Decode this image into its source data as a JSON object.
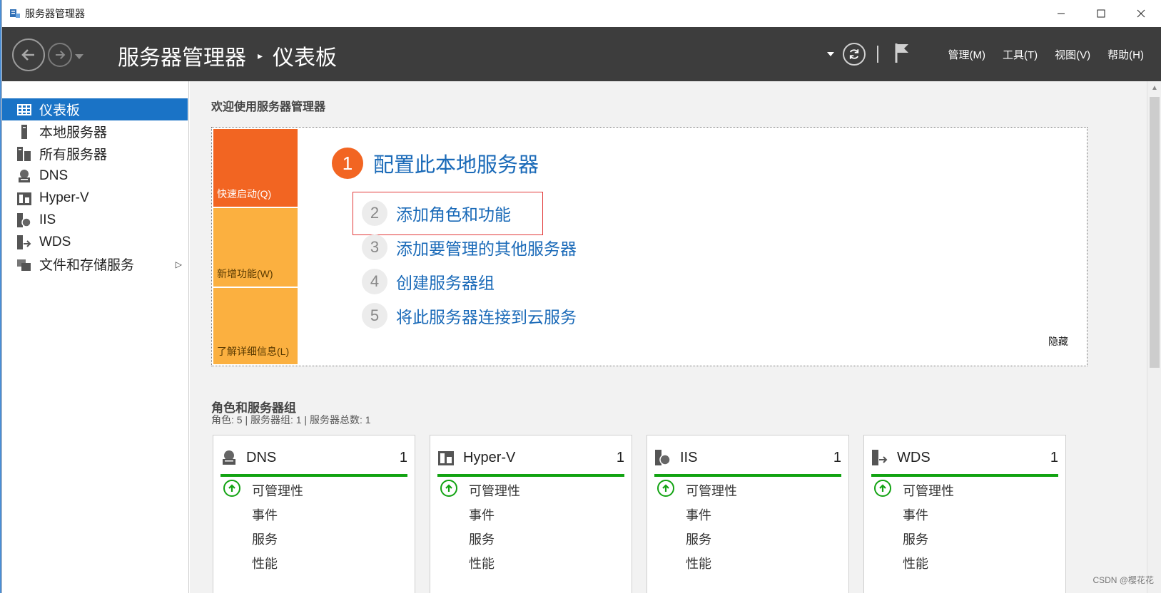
{
  "window": {
    "title": "服务器管理器"
  },
  "header": {
    "breadcrumb_root": "服务器管理器",
    "breadcrumb_sep": "▸",
    "breadcrumb_current": "仪表板",
    "menus": [
      "管理(M)",
      "工具(T)",
      "视图(V)",
      "帮助(H)"
    ]
  },
  "sidebar": {
    "items": [
      {
        "label": "仪表板",
        "icon": "dashboard-icon"
      },
      {
        "label": "本地服务器",
        "icon": "server-icon"
      },
      {
        "label": "所有服务器",
        "icon": "servers-icon"
      },
      {
        "label": "DNS",
        "icon": "dns-icon"
      },
      {
        "label": "Hyper-V",
        "icon": "hyperv-icon"
      },
      {
        "label": "IIS",
        "icon": "iis-icon"
      },
      {
        "label": "WDS",
        "icon": "wds-icon"
      },
      {
        "label": "文件和存储服务",
        "icon": "storage-icon"
      }
    ]
  },
  "main": {
    "welcome_title": "欢迎使用服务器管理器",
    "tiles": [
      "快速启动(Q)",
      "新增功能(W)",
      "了解详细信息(L)"
    ],
    "steps": [
      {
        "num": "1",
        "label": "配置此本地服务器"
      },
      {
        "num": "2",
        "label": "添加角色和功能"
      },
      {
        "num": "3",
        "label": "添加要管理的其他服务器"
      },
      {
        "num": "4",
        "label": "创建服务器组"
      },
      {
        "num": "5",
        "label": "将此服务器连接到云服务"
      }
    ],
    "hide_link": "隐藏",
    "roles_title": "角色和服务器组",
    "roles_sub": "角色: 5 | 服务器组: 1 | 服务器总数: 1",
    "cards": [
      {
        "name": "DNS",
        "count": "1",
        "rows": [
          "可管理性",
          "事件",
          "服务",
          "性能"
        ]
      },
      {
        "name": "Hyper-V",
        "count": "1",
        "rows": [
          "可管理性",
          "事件",
          "服务",
          "性能"
        ]
      },
      {
        "name": "IIS",
        "count": "1",
        "rows": [
          "可管理性",
          "事件",
          "服务",
          "性能"
        ]
      },
      {
        "name": "WDS",
        "count": "1",
        "rows": [
          "可管理性",
          "事件",
          "服务",
          "性能"
        ]
      }
    ]
  },
  "watermark": "CSDN @樱花花",
  "colors": {
    "accent_blue": "#1a73c6",
    "orange": "#f26522",
    "amber": "#fbb040",
    "ok_green": "#12a312",
    "header_bg": "#3d3d3d"
  }
}
